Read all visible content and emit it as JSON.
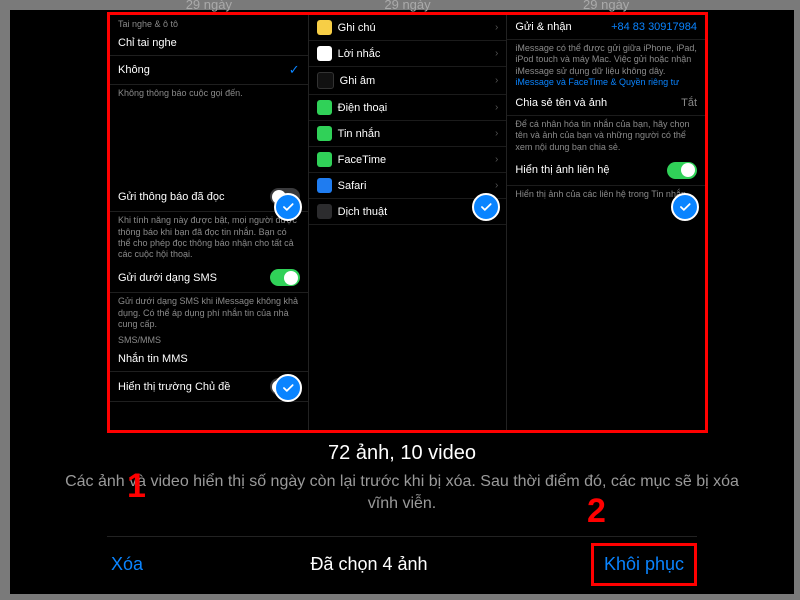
{
  "days_label": "29 ngày",
  "col1": {
    "section_top": "Tai nghe & ô tô",
    "chi_tai_nghe": "Chỉ tai nghe",
    "khong": "Không",
    "khong_help": "Không thông báo cuộc gọi đến.",
    "read_receipt": "Gửi thông báo đã đọc",
    "read_help": "Khi tính năng này được bật, mọi người được thông báo khi bạn đã đọc tin nhắn. Bạn có thể cho phép đọc thông báo nhận cho tất cả các cuộc hội thoại.",
    "sms": "Gửi dưới dạng SMS",
    "sms_help": "Gửi dưới dạng SMS khi iMessage không khả dụng. Có thể áp dụng phí nhắn tin của nhà cung cấp.",
    "sms_mms": "SMS/MMS",
    "mms": "Nhắn tin MMS",
    "subj": "Hiển thị trường Chủ đề"
  },
  "col2": {
    "items": [
      "Ghi chú",
      "Lời nhắc",
      "Ghi âm",
      "Điện thoại",
      "Tin nhắn",
      "FaceTime",
      "Safari",
      "Dịch thuật"
    ]
  },
  "col3": {
    "send_recv": "Gửi & nhận",
    "phone": "+84 83 30917984",
    "imsg_help1": "iMessage có thể được gửi giữa iPhone, iPad, iPod touch và máy Mac. Việc gửi hoặc nhận iMessage sử dụng dữ liệu không dây. ",
    "imsg_link": "iMessage và FaceTime & Quyền riêng tư",
    "share": "Chia sẻ tên và ảnh",
    "share_state": "Tắt",
    "share_help": "Để cá nhân hóa tin nhắn của bạn, hãy chọn tên và ảnh của bạn và những người có thể xem nội dung bạn chia sẻ.",
    "contact_photo": "Hiển thị ảnh liên hệ",
    "contact_help": "Hiển thị ảnh của các liên hệ trong Tin nhắn."
  },
  "info": {
    "count": "72 ảnh, 10 video",
    "desc": "Các ảnh và video hiển thị số ngày còn lại trước khi bị xóa. Sau thời điểm đó, các mục sẽ bị xóa vĩnh viễn."
  },
  "callouts": {
    "one": "1",
    "two": "2"
  },
  "bottom": {
    "delete": "Xóa",
    "selected": "Đã chọn 4 ảnh",
    "restore": "Khôi phục"
  }
}
